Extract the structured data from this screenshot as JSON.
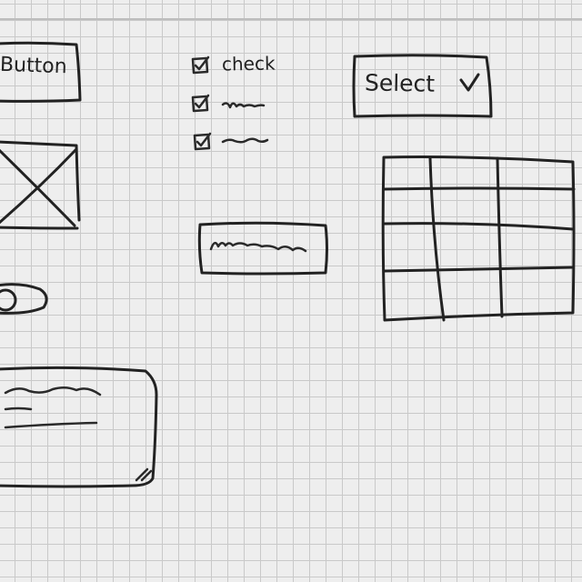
{
  "button": {
    "label": "Button"
  },
  "checkboxes": [
    {
      "label": "check",
      "checked": true
    },
    {
      "label": "",
      "checked": true
    },
    {
      "label": "",
      "checked": true
    }
  ],
  "select": {
    "value": "Select",
    "icon": "chevron-down-icon"
  },
  "image_placeholder": {
    "icon": "x-placeholder-icon"
  },
  "text_input": {
    "placeholder": ""
  },
  "toggle": {
    "on": false
  },
  "textarea": {
    "icon": "resize-handle-icon"
  },
  "table": {
    "rows": 3,
    "columns": 3
  },
  "colors": {
    "paper": "#eeeeee",
    "grid": "#c9c9c9",
    "ink": "#222222"
  }
}
